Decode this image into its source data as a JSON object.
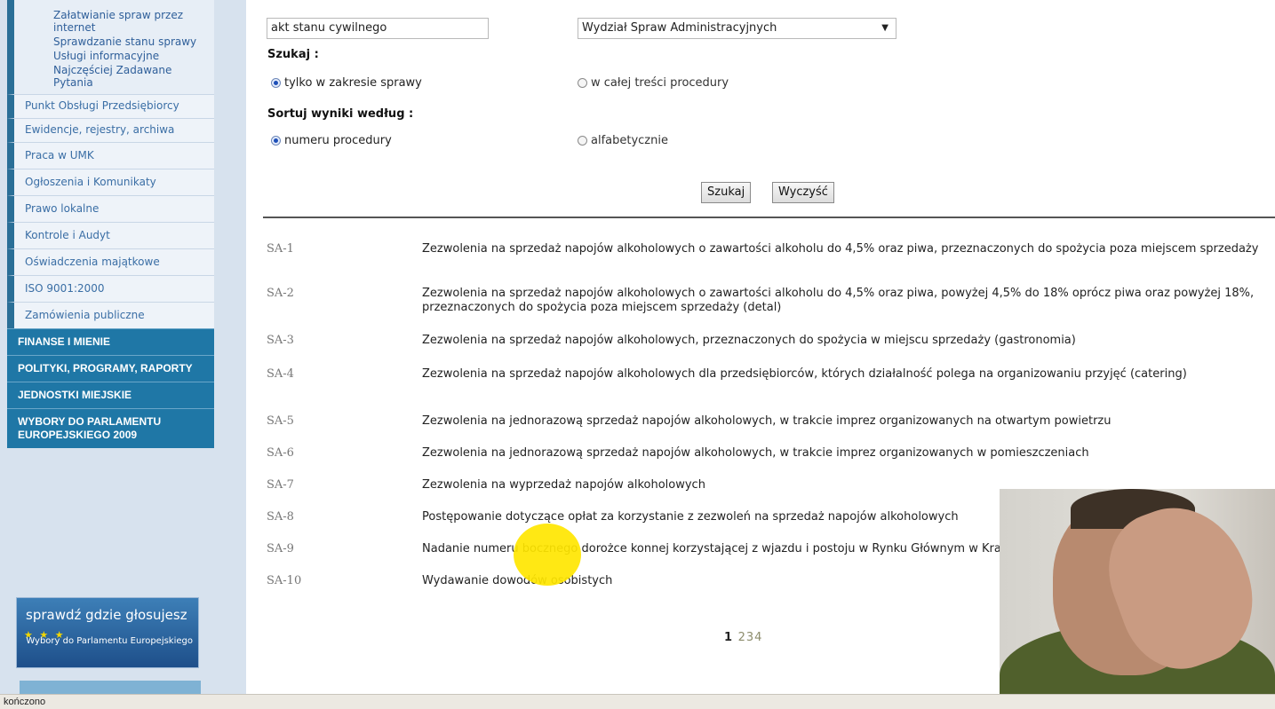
{
  "sidebar": {
    "sub_items": [
      {
        "label": "Załatwianie spraw przez internet"
      },
      {
        "label": "Sprawdzanie stanu sprawy"
      },
      {
        "label": "Usługi informacyjne"
      },
      {
        "label": "Najczęściej Zadawane Pytania"
      }
    ],
    "items": [
      {
        "label": "Punkt Obsługi Przedsiębiorcy"
      },
      {
        "label": "Ewidencje, rejestry, archiwa"
      },
      {
        "label": "Praca w UMK"
      },
      {
        "label": "Ogłoszenia i Komunikaty"
      },
      {
        "label": "Prawo lokalne"
      },
      {
        "label": "Kontrole i Audyt"
      },
      {
        "label": "Oświadczenia majątkowe"
      },
      {
        "label": "ISO 9001:2000"
      },
      {
        "label": "Zamówienia publiczne"
      }
    ],
    "sections": [
      {
        "label": "FINANSE I MIENIE"
      },
      {
        "label": "POLITYKI, PROGRAMY, RAPORTY"
      },
      {
        "label": "JEDNOSTKI MIEJSKIE"
      },
      {
        "label": "WYBORY DO PARLAMENTU EUROPEJSKIEGO 2009"
      }
    ],
    "banner": {
      "title": "sprawdź gdzie głosujesz",
      "subtitle": "Wybory do Parlamentu Europejskiego"
    }
  },
  "form": {
    "search_value": "akt stanu cywilnego",
    "department_value": "Wydział Spraw Administracyjnych",
    "search_label": "Szukaj :",
    "scope_option1": "tylko w zakresie sprawy",
    "scope_option2": "w całej treści procedury",
    "sort_label": "Sortuj wyniki według :",
    "sort_option1": "numeru procedury",
    "sort_option2": "alfabetycznie",
    "search_button": "Szukaj",
    "clear_button": "Wyczyść"
  },
  "results": [
    {
      "code": "SA-1",
      "desc": "Zezwolenia na sprzedaż napojów alkoholowych o zawartości alkoholu do 4,5% oraz piwa, przeznaczonych do spożycia poza miejscem sprzedaży"
    },
    {
      "code": "SA-2",
      "desc": "Zezwolenia na sprzedaż napojów alkoholowych o zawartości alkoholu do 4,5% oraz piwa, powyżej 4,5% do 18% oprócz piwa oraz powyżej 18%, przeznaczonych do spożycia poza miejscem sprzedaży (detal)"
    },
    {
      "code": "SA-3",
      "desc": "Zezwolenia na sprzedaż napojów alkoholowych, przeznaczonych do spożycia w miejscu sprzedaży (gastronomia)"
    },
    {
      "code": "SA-4",
      "desc": "Zezwolenia na sprzedaż napojów alkoholowych dla przedsiębiorców, których działalność polega na organizowaniu przyjęć (catering)"
    },
    {
      "code": "SA-5",
      "desc": "Zezwolenia na jednorazową sprzedaż napojów alkoholowych, w trakcie imprez organizowanych na otwartym powietrzu"
    },
    {
      "code": "SA-6",
      "desc": "Zezwolenia na jednorazową sprzedaż napojów alkoholowych, w trakcie imprez organizowanych w pomieszczeniach"
    },
    {
      "code": "SA-7",
      "desc": "Zezwolenia na wyprzedaż napojów alkoholowych"
    },
    {
      "code": "SA-8",
      "desc": "Postępowanie dotyczące opłat za korzystanie z zezwoleń na sprzedaż napojów alkoholowych"
    },
    {
      "code": "SA-9",
      "desc": "Nadanie numeru bocznego dorożce konnej korzystającej z wjazdu i postoju w Rynku Głównym w Krakowie"
    },
    {
      "code": "SA-10",
      "desc": "Wydawanie dowodów osobistych"
    }
  ],
  "pager": {
    "current": "1",
    "pages": [
      "2",
      "3",
      "4"
    ]
  },
  "status": {
    "text": "kończono"
  }
}
